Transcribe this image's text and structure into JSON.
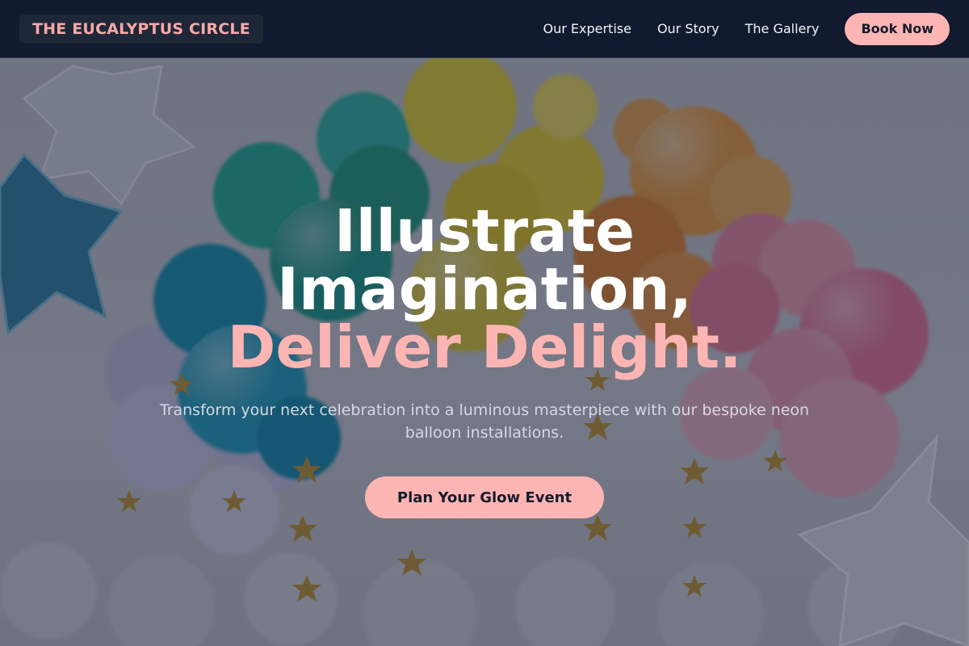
{
  "header": {
    "brand": "THE EUCALYPTUS CIRCLE",
    "nav": [
      {
        "label": "Our Expertise"
      },
      {
        "label": "Our Story"
      },
      {
        "label": "The Gallery"
      }
    ],
    "book_button": "Book Now"
  },
  "hero": {
    "headline_line1": "Illustrate",
    "headline_line2": "Imagination,",
    "headline_accent": "Deliver Delight.",
    "subtitle": "Transform your next celebration into a luminous masterpiece with our bespoke neon balloon installations.",
    "cta_button": "Plan Your Glow Event",
    "background_description_icon": "balloon-arch-photo"
  },
  "colors": {
    "nav_background": "#111a2e",
    "brand_badge_background": "#1e2738",
    "accent_pink": "#fcb5b3",
    "text_white": "#ffffff",
    "subtitle_text": "#d6d9e2",
    "button_text": "#151b2c"
  }
}
